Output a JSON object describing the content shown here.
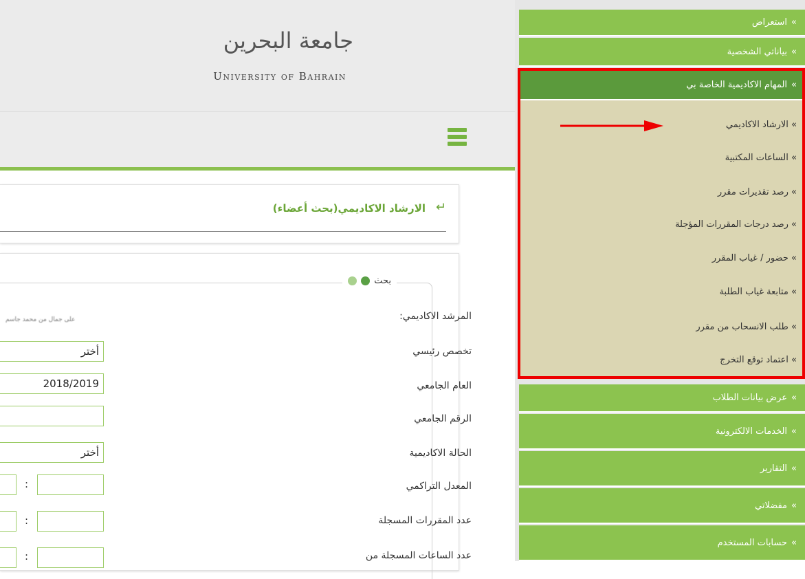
{
  "header": {
    "university_ar": "جامعة البحرين",
    "university_en": "University of Bahrain"
  },
  "page": {
    "title": "الارشاد الاكاديمي(بحث أعضاء)"
  },
  "search_form": {
    "legend": "بحث",
    "fields": {
      "advisor_label": "المرشد الاكاديمي:",
      "advisor_value": "على جمال من محمد جاسم",
      "major_label": "تخصص رئيسي",
      "major_value": "أختر",
      "year_label": "العام الجامعي",
      "year_value": "2018/2019",
      "student_id_label": "الرقم الجامعي",
      "student_id_value": "",
      "status_label": "الحالة الاكاديمية",
      "status_value": "أختر",
      "gpa_label": "المعدل التراكمي",
      "courses_label": "عدد المقررات المسجلة",
      "hours_label": "عدد الساعات المسجلة من",
      "range_separator": ":"
    }
  },
  "sidebar": {
    "bullet": "»",
    "top_items": [
      "استعراض",
      "بياناتي الشخصية"
    ],
    "active_item": "المهام الاكاديمية الخاصة بي",
    "sub_items": [
      "الارشاد الاكاديمي",
      "الساعات المكتبية",
      "رصد تقديرات مقرر",
      "رصد درجات المقررات المؤجلة",
      "حضور / غياب المقرر",
      "متابعة غياب الطلبة",
      "طلب الانسحاب من مقرر",
      "اعتماد توقع التخرج"
    ],
    "bottom_items": [
      "عرض بيانات الطلاب",
      "الخدمات الالكترونية",
      "التقارير",
      "مفضلاتي",
      "حسابات المستخدم"
    ]
  },
  "colors": {
    "sidebar_green": "#8cc34f",
    "sidebar_active": "#5b9a3c",
    "submenu_bg": "#dbd6b3",
    "highlight_red": "#ee0000",
    "title_green": "#6aa536"
  }
}
